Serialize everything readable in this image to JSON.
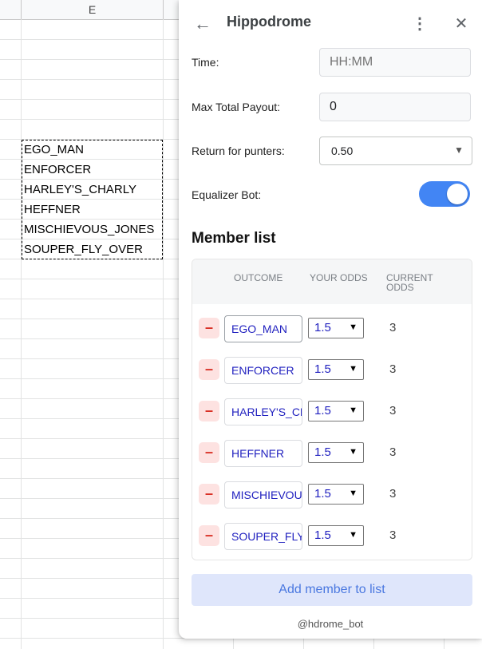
{
  "sheet": {
    "column_header": "E",
    "cells": [
      "EGO_MAN",
      "ENFORCER",
      "HARLEY'S_CHARLY",
      "HEFFNER",
      "MISCHIEVOUS_JONES",
      "SOUPER_FLY_OVER"
    ]
  },
  "panel": {
    "title": "Hippodrome",
    "back_icon": "←",
    "more_icon": "⋮",
    "close_icon": "✕",
    "time_label": "Time:",
    "time_placeholder": "HH:MM",
    "payout_label": "Max Total Payout:",
    "payout_value": "0",
    "return_label": "Return for punters:",
    "return_value": "0.50",
    "equalizer_label": "Equalizer Bot:",
    "equalizer_on": true,
    "member_list_title": "Member list",
    "headers": {
      "outcome": "OUTCOME",
      "your_odds": "YOUR ODDS",
      "current_odds_1": "CURRENT",
      "current_odds_2": "ODDS"
    },
    "members": [
      {
        "name": "EGO_MAN",
        "odds": "1.5",
        "current": "3"
      },
      {
        "name": "ENFORCER",
        "odds": "1.5",
        "current": "3"
      },
      {
        "name": "HARLEY'S_CHARLY",
        "odds": "1.5",
        "current": "3"
      },
      {
        "name": "HEFFNER",
        "odds": "1.5",
        "current": "3"
      },
      {
        "name": "MISCHIEVOUS_JONES",
        "odds": "1.5",
        "current": "3"
      },
      {
        "name": "SOUPER_FLY_OVER",
        "odds": "1.5",
        "current": "3"
      }
    ],
    "remove_icon": "–",
    "add_button": "Add member to list",
    "footer": "@hdrome_bot"
  },
  "colors": {
    "accent": "#4285f4",
    "remove": "#d93025",
    "add_button_bg": "#dfe6fb",
    "add_button_text": "#4a78e0"
  }
}
